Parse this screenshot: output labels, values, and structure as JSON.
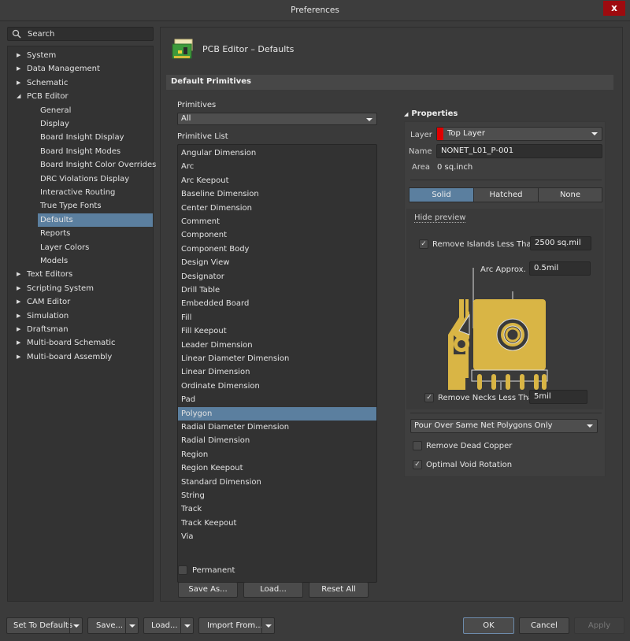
{
  "window": {
    "title": "Preferences",
    "close_label": "x"
  },
  "search": {
    "placeholder": "Search"
  },
  "tree": [
    {
      "label": "System",
      "level": 0,
      "expanded": false
    },
    {
      "label": "Data Management",
      "level": 0,
      "expanded": false
    },
    {
      "label": "Schematic",
      "level": 0,
      "expanded": false
    },
    {
      "label": "PCB Editor",
      "level": 0,
      "expanded": true
    },
    {
      "label": "General",
      "level": 1
    },
    {
      "label": "Display",
      "level": 1
    },
    {
      "label": "Board Insight Display",
      "level": 1
    },
    {
      "label": "Board Insight Modes",
      "level": 1
    },
    {
      "label": "Board Insight Color Overrides",
      "level": 1
    },
    {
      "label": "DRC Violations Display",
      "level": 1
    },
    {
      "label": "Interactive Routing",
      "level": 1
    },
    {
      "label": "True Type Fonts",
      "level": 1
    },
    {
      "label": "Defaults",
      "level": 1,
      "selected": true
    },
    {
      "label": "Reports",
      "level": 1
    },
    {
      "label": "Layer Colors",
      "level": 1
    },
    {
      "label": "Models",
      "level": 1
    },
    {
      "label": "Text Editors",
      "level": 0,
      "expanded": false
    },
    {
      "label": "Scripting System",
      "level": 0,
      "expanded": false
    },
    {
      "label": "CAM Editor",
      "level": 0,
      "expanded": false
    },
    {
      "label": "Simulation",
      "level": 0,
      "expanded": false
    },
    {
      "label": "Draftsman",
      "level": 0,
      "expanded": false
    },
    {
      "label": "Multi-board Schematic",
      "level": 0,
      "expanded": false
    },
    {
      "label": "Multi-board Assembly",
      "level": 0,
      "expanded": false
    }
  ],
  "page": {
    "title": "PCB Editor – Defaults",
    "section": "Default Primitives"
  },
  "primitives": {
    "label": "Primitives",
    "selected": "All",
    "list_label": "Primitive List",
    "items": [
      "Angular Dimension",
      "Arc",
      "Arc Keepout",
      "Baseline Dimension",
      "Center Dimension",
      "Comment",
      "Component",
      "Component Body",
      "Design View",
      "Designator",
      "Drill Table",
      "Embedded Board",
      "Fill",
      "Fill Keepout",
      "Leader Dimension",
      "Linear Diameter Dimension",
      "Linear Dimension",
      "Ordinate Dimension",
      "Pad",
      "Polygon",
      "Radial Diameter Dimension",
      "Radial Dimension",
      "Region",
      "Region Keepout",
      "Standard Dimension",
      "String",
      "Track",
      "Track Keepout",
      "Via"
    ],
    "selected_item": "Polygon",
    "permanent_label": "Permanent",
    "permanent_checked": false,
    "buttons": {
      "save_as": "Save As...",
      "load": "Load...",
      "reset_all": "Reset All"
    }
  },
  "properties": {
    "heading": "Properties",
    "layer_label": "Layer",
    "layer_value": "Top Layer",
    "layer_color": "#e00000",
    "name_label": "Name",
    "name_value": "NONET_L01_P-001",
    "area_label": "Area",
    "area_value": "0 sq.inch",
    "fill_modes": [
      "Solid",
      "Hatched",
      "None"
    ],
    "fill_mode_active": "Solid",
    "hide_preview": "Hide preview",
    "remove_islands_label": "Remove Islands Less Than",
    "remove_islands_checked": true,
    "remove_islands_value": "2500 sq.mil",
    "arc_approx_label": "Arc Approx.",
    "arc_approx_value": "0.5mil",
    "remove_necks_label": "Remove Necks Less Than",
    "remove_necks_checked": true,
    "remove_necks_value": "5mil",
    "pour_over": "Pour Over Same Net Polygons Only",
    "remove_dead_copper_label": "Remove Dead Copper",
    "remove_dead_copper_checked": false,
    "optimal_void_label": "Optimal Void Rotation",
    "optimal_void_checked": true,
    "preview_color": "#d9b545"
  },
  "footer": {
    "set_defaults": "Set To Defaults",
    "save": "Save...",
    "load": "Load...",
    "import_from": "Import From...",
    "ok": "OK",
    "cancel": "Cancel",
    "apply": "Apply"
  }
}
